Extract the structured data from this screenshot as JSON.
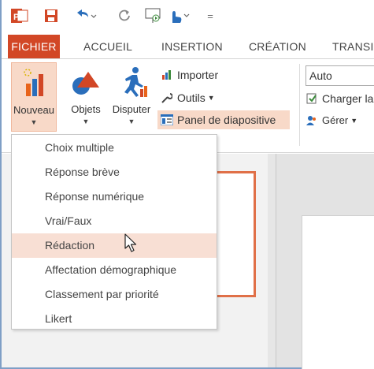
{
  "quick_access": {
    "icons": [
      "powerpoint-logo-icon",
      "save-icon",
      "undo-icon",
      "redo-icon",
      "presentation-icon",
      "touch-mode-icon",
      "customize-icon"
    ],
    "customize_glyph": "="
  },
  "tabs": [
    {
      "label": "FICHIER"
    },
    {
      "label": "ACCUEIL"
    },
    {
      "label": "INSERTION"
    },
    {
      "label": "CRÉATION"
    },
    {
      "label": "TRANSI"
    }
  ],
  "ribbon": {
    "nouveau": "Nouveau",
    "objets": "Objets",
    "disputer": "Disputer",
    "importer": "Importer",
    "outils": "Outils",
    "panel": "Panel de diapositive",
    "auto": "Auto",
    "charger": "Charger la",
    "gerer": "Gérer"
  },
  "menu": {
    "items": [
      {
        "label": "Choix multiple"
      },
      {
        "label": "Réponse brève"
      },
      {
        "label": "Réponse numérique"
      },
      {
        "label": "Vrai/Faux"
      },
      {
        "label": "Rédaction"
      },
      {
        "label": "Affectation démographique"
      },
      {
        "label": "Classement par priorité"
      },
      {
        "label": "Likert"
      }
    ],
    "highlighted_index": 4
  },
  "colors": {
    "file_tab": "#d24726",
    "highlight": "#f8dfd4",
    "thumb_border": "#e07048"
  }
}
